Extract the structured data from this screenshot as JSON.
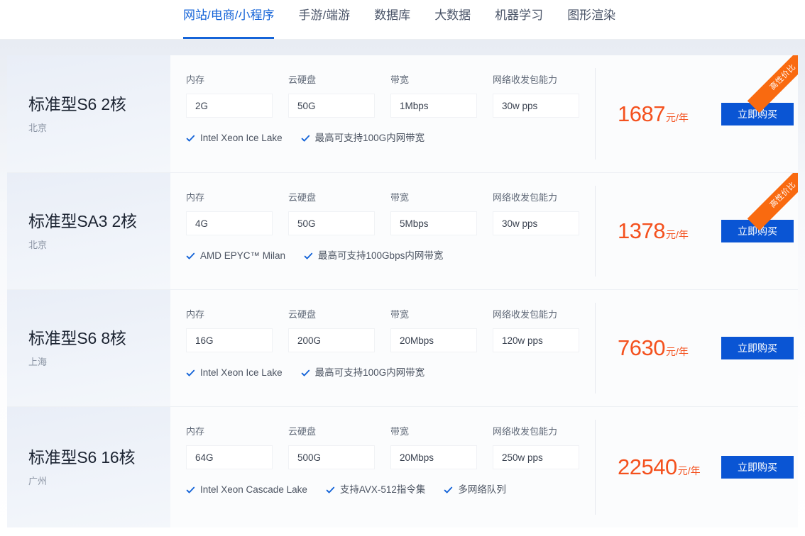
{
  "tabs": [
    {
      "label": "网站/电商/小程序",
      "active": true
    },
    {
      "label": "手游/端游",
      "active": false
    },
    {
      "label": "数据库",
      "active": false
    },
    {
      "label": "大数据",
      "active": false
    },
    {
      "label": "机器学习",
      "active": false
    },
    {
      "label": "图形渲染",
      "active": false
    }
  ],
  "labels": {
    "memory": "内存",
    "disk": "云硬盘",
    "bandwidth": "带宽",
    "pps": "网络收发包能力",
    "buy": "立即购买",
    "ribbon": "高性价比"
  },
  "colors": {
    "accent_blue": "#1564d8",
    "button_blue": "#0a55d4",
    "price_orange": "#f4511e",
    "ribbon_orange": "#f96a10",
    "check_blue": "#1564d8"
  },
  "cards": [
    {
      "title": "标准型S6 2核",
      "region": "北京",
      "memory": "2G",
      "disk": "50G",
      "bandwidth": "1Mbps",
      "pps": "30w pps",
      "features": [
        "Intel Xeon Ice Lake",
        "最高可支持100G内网带宽"
      ],
      "price": "1687",
      "price_unit": "元/年",
      "buy": "立即购买",
      "ribbon": "高性价比"
    },
    {
      "title": "标准型SA3 2核",
      "region": "北京",
      "memory": "4G",
      "disk": "50G",
      "bandwidth": "5Mbps",
      "pps": "30w pps",
      "features": [
        "AMD EPYC™ Milan",
        "最高可支持100Gbps内网带宽"
      ],
      "price": "1378",
      "price_unit": "元/年",
      "buy": "立即购买",
      "ribbon": "高性价比"
    },
    {
      "title": "标准型S6 8核",
      "region": "上海",
      "memory": "16G",
      "disk": "200G",
      "bandwidth": "20Mbps",
      "pps": "120w pps",
      "features": [
        "Intel Xeon Ice Lake",
        "最高可支持100G内网带宽"
      ],
      "price": "7630",
      "price_unit": "元/年",
      "buy": "立即购买",
      "ribbon": ""
    },
    {
      "title": "标准型S6 16核",
      "region": "广州",
      "memory": "64G",
      "disk": "500G",
      "bandwidth": "20Mbps",
      "pps": "250w pps",
      "features": [
        "Intel Xeon Cascade Lake",
        "支持AVX-512指令集",
        "多网络队列"
      ],
      "price": "22540",
      "price_unit": "元/年",
      "buy": "立即购买",
      "ribbon": ""
    }
  ]
}
